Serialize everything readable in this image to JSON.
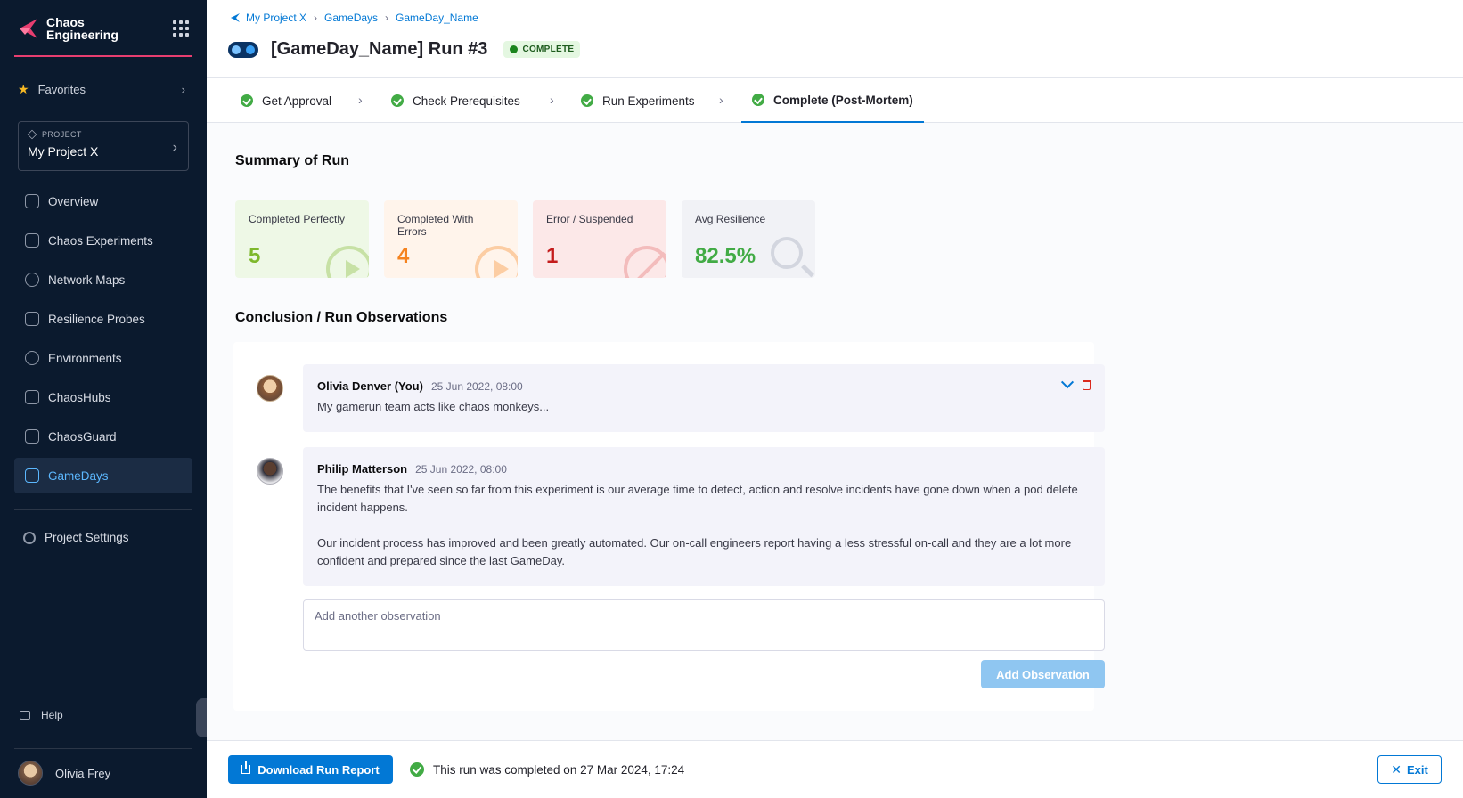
{
  "app": {
    "title": "Chaos Engineering"
  },
  "sidebar": {
    "favorites_label": "Favorites",
    "project_label": "PROJECT",
    "project_name": "My Project X",
    "items": [
      {
        "label": "Overview",
        "icon": "home-icon"
      },
      {
        "label": "Chaos Experiments",
        "icon": "flask-icon"
      },
      {
        "label": "Network Maps",
        "icon": "network-icon"
      },
      {
        "label": "Resilience Probes",
        "icon": "probe-icon"
      },
      {
        "label": "Environments",
        "icon": "environment-icon"
      },
      {
        "label": "ChaosHubs",
        "icon": "hub-icon"
      },
      {
        "label": "ChaosGuard",
        "icon": "guard-icon"
      },
      {
        "label": "GameDays",
        "icon": "gamepad-icon",
        "active": true
      }
    ],
    "settings_label": "Project Settings",
    "help_label": "Help",
    "user_name": "Olivia Frey"
  },
  "breadcrumb": [
    "My Project X",
    "GameDays",
    "GameDay_Name"
  ],
  "header": {
    "title": "[GameDay_Name] Run #3",
    "status": "COMPLETE"
  },
  "tabs": [
    {
      "label": "Get Approval"
    },
    {
      "label": "Check Prerequisites"
    },
    {
      "label": "Run Experiments"
    },
    {
      "label": "Complete (Post-Mortem)",
      "active": true
    }
  ],
  "summary": {
    "title": "Summary of Run",
    "cards": [
      {
        "label": "Completed Perfectly",
        "value": "5",
        "color": "#7eb82c",
        "bg": "#eef8e6"
      },
      {
        "label": "Completed With Errors",
        "value": "4",
        "color": "#f5831f",
        "bg": "#fff4eb"
      },
      {
        "label": "Error / Suspended",
        "value": "1",
        "color": "#c41c1c",
        "bg": "#fce8e8"
      },
      {
        "label": "Avg Resilience",
        "value": "82.5%",
        "color": "#42ab45",
        "bg": "#f1f2f6"
      }
    ]
  },
  "observations": {
    "title": "Conclusion / Run Observations",
    "comments": [
      {
        "author": "Olivia Denver (You)",
        "time": "25 Jun 2022, 08:00",
        "body": [
          "My gamerun team acts like chaos monkeys..."
        ]
      },
      {
        "author": "Philip Matterson",
        "time": "25 Jun 2022, 08:00",
        "body": [
          "The benefits that I've seen so far from this experiment is our average time to detect, action and resolve incidents have gone down when a pod delete incident happens.",
          "Our incident process has improved and been greatly automated. Our on-call engineers report having a less stressful on-call and they are a lot more confident and prepared since the last GameDay."
        ]
      }
    ],
    "input_placeholder": "Add another observation",
    "add_label": "Add Observation"
  },
  "footer": {
    "download_label": "Download Run Report",
    "completed_text": "This run was completed on 27 Mar 2024, 17:24",
    "exit_label": "Exit"
  },
  "colors": {
    "accent": "#0278d5",
    "sidebar_bg": "#0b1a2e",
    "brand": "#e83e70",
    "success": "#42ab45"
  }
}
